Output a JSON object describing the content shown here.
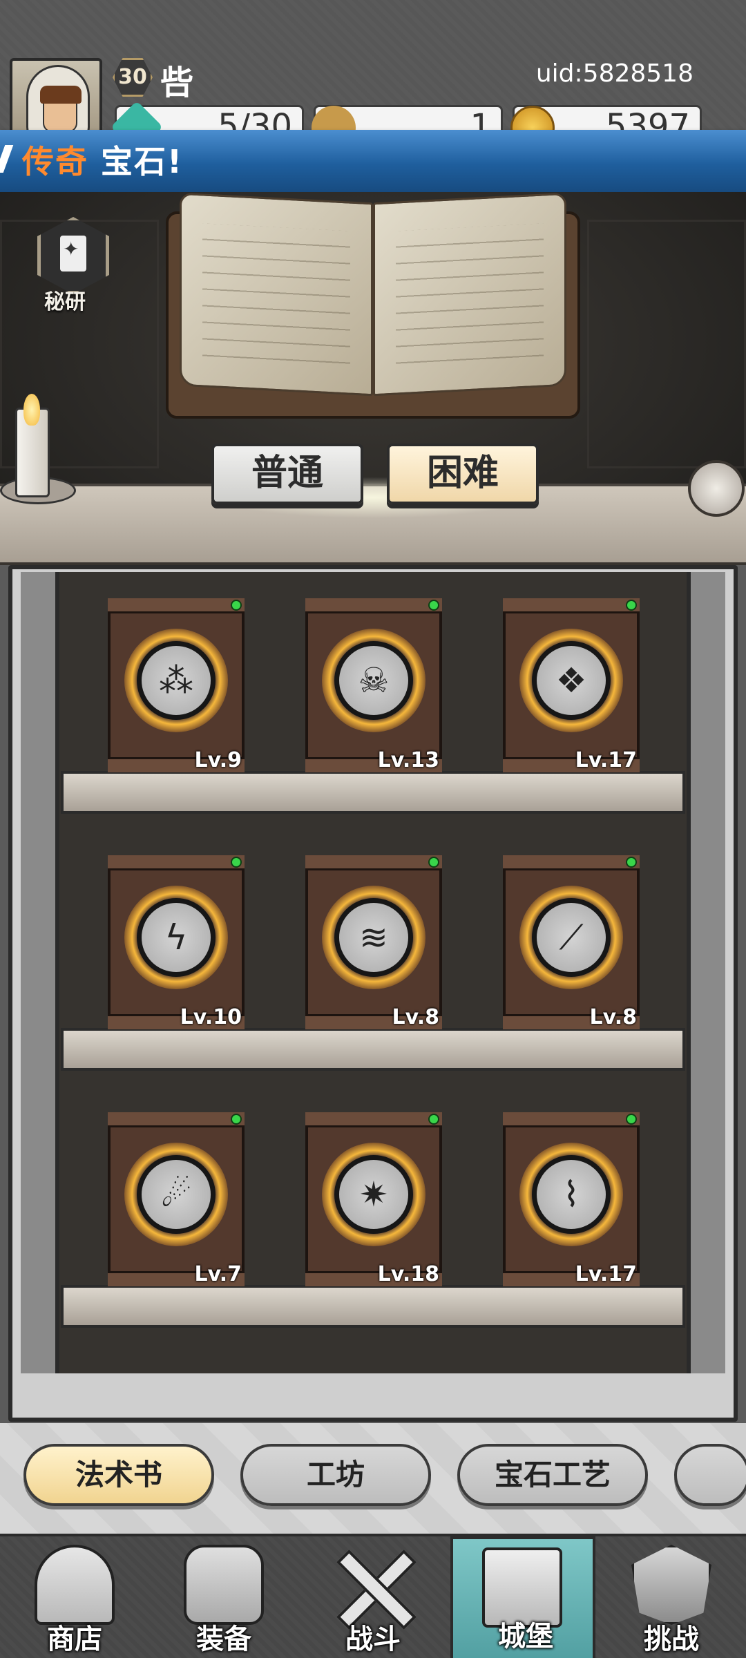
{
  "header": {
    "level": "30",
    "player_name": "呰",
    "uid": "uid:5828518",
    "resources": {
      "energy": "5/30",
      "keys": "1",
      "gold": "5397"
    }
  },
  "banner": {
    "highlight": "传奇",
    "text": "宝石!"
  },
  "scene": {
    "research_label": "秘研",
    "modes": {
      "normal": "普通",
      "hard": "困难"
    }
  },
  "spellbooks": [
    {
      "icon": "dark-drops-icon",
      "glyph": "⁂",
      "level": "Lv.9"
    },
    {
      "icon": "skull-drip-icon",
      "glyph": "☠",
      "level": "Lv.13"
    },
    {
      "icon": "ice-crystal-icon",
      "glyph": "❖",
      "level": "Lv.17"
    },
    {
      "icon": "lightning-strike-icon",
      "glyph": "ϟ",
      "level": "Lv.10"
    },
    {
      "icon": "icicle-rain-icon",
      "glyph": "≋",
      "level": "Lv.8"
    },
    {
      "icon": "meteor-slash-icon",
      "glyph": "⟋",
      "level": "Lv.8"
    },
    {
      "icon": "comet-icon",
      "glyph": "☄",
      "level": "Lv.7"
    },
    {
      "icon": "crystal-shatter-icon",
      "glyph": "✷",
      "level": "Lv.18"
    },
    {
      "icon": "chain-lightning-icon",
      "glyph": "⌇",
      "level": "Lv.17"
    }
  ],
  "tabs": [
    {
      "label": "法术书",
      "active": true
    },
    {
      "label": "工坊",
      "active": false
    },
    {
      "label": "宝石工艺",
      "active": false
    }
  ],
  "nav": [
    {
      "label": "商店",
      "icon": "shop-icon"
    },
    {
      "label": "装备",
      "icon": "equipment-bag-icon"
    },
    {
      "label": "战斗",
      "icon": "crossed-swords-icon"
    },
    {
      "label": "城堡",
      "icon": "castle-icon",
      "active": true
    },
    {
      "label": "挑战",
      "icon": "challenge-shield-icon"
    }
  ],
  "colors": {
    "banner_blue": "#1f5f9e",
    "banner_highlight": "#ff8a2e",
    "new_dot": "#39d64a",
    "active_tab": "#f1d490",
    "active_nav": "#52a0a2"
  }
}
